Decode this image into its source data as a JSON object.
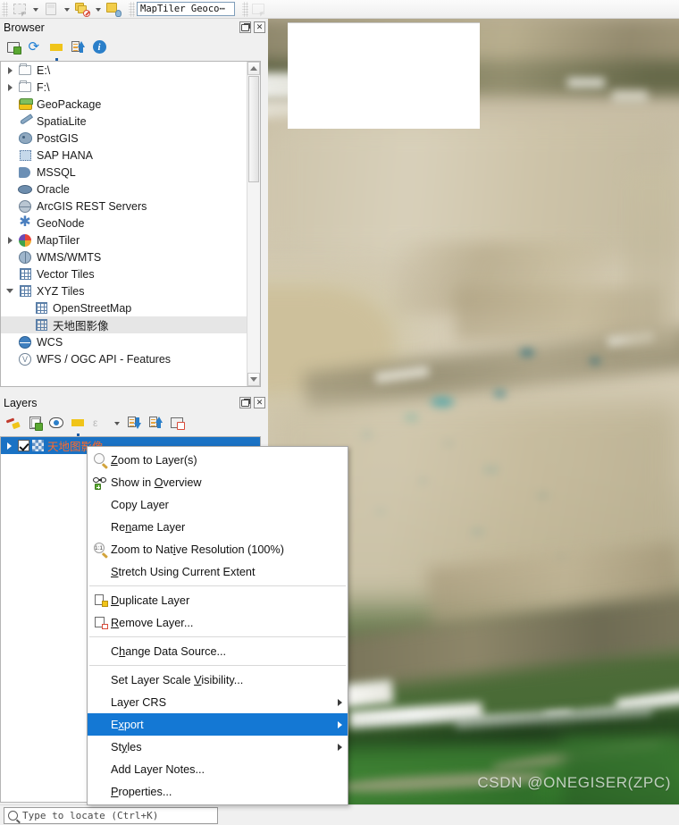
{
  "toolbar": {
    "items": [
      {
        "name": "select-features-tool",
        "icon": "select-icon",
        "disabled": true
      },
      {
        "name": "select-dropdown",
        "icon": "chevron-down-icon"
      },
      {
        "name": "deselect-features-tool",
        "icon": "deselect-icon",
        "disabled": true
      },
      {
        "name": "deselect-dropdown",
        "icon": "chevron-down-icon"
      },
      {
        "name": "open-attribute-table",
        "icon": "layers-remove-icon"
      },
      {
        "name": "attribute-dropdown",
        "icon": "chevron-down-icon"
      },
      {
        "name": "show-map-tips",
        "icon": "layer-tip-icon"
      }
    ],
    "geocoder_value": "MapTiler Geoco⋯",
    "geocoder_placeholder": "MapTiler Geocoder"
  },
  "browser": {
    "title": "Browser",
    "window_buttons": [
      {
        "name": "float-panel-button",
        "glyph": "❐"
      },
      {
        "name": "close-panel-button",
        "glyph": "✕"
      }
    ],
    "toolbar": [
      {
        "name": "add-selected-layers-button",
        "icon": "new-layer-icon"
      },
      {
        "name": "refresh-button",
        "icon": "refresh-icon"
      },
      {
        "name": "filter-browser-button",
        "icon": "filter-icon"
      },
      {
        "name": "collapse-all-button",
        "icon": "collapse-all-icon"
      },
      {
        "name": "enable-properties-widget-button",
        "icon": "info-icon"
      }
    ],
    "tree": [
      {
        "label": "E:\\",
        "icon": "folder-icon",
        "indent": 0,
        "twisty": "closed",
        "selected": false
      },
      {
        "label": "F:\\",
        "icon": "folder-icon",
        "indent": 0,
        "twisty": "closed",
        "selected": false
      },
      {
        "label": "GeoPackage",
        "icon": "geopackage-icon",
        "indent": 0,
        "twisty": "none",
        "selected": false
      },
      {
        "label": "SpatiaLite",
        "icon": "spatialite-icon",
        "indent": 0,
        "twisty": "none",
        "selected": false
      },
      {
        "label": "PostGIS",
        "icon": "postgis-icon",
        "indent": 0,
        "twisty": "none",
        "selected": false
      },
      {
        "label": "SAP HANA",
        "icon": "sap-hana-icon",
        "indent": 0,
        "twisty": "none",
        "selected": false
      },
      {
        "label": "MSSQL",
        "icon": "mssql-icon",
        "indent": 0,
        "twisty": "none",
        "selected": false
      },
      {
        "label": "Oracle",
        "icon": "oracle-icon",
        "indent": 0,
        "twisty": "none",
        "selected": false
      },
      {
        "label": "ArcGIS REST Servers",
        "icon": "arcgis-icon",
        "indent": 0,
        "twisty": "none",
        "selected": false
      },
      {
        "label": "GeoNode",
        "icon": "geonode-icon",
        "indent": 0,
        "twisty": "none",
        "selected": false
      },
      {
        "label": "MapTiler",
        "icon": "maptiler-icon",
        "indent": 0,
        "twisty": "closed",
        "selected": false
      },
      {
        "label": "WMS/WMTS",
        "icon": "wms-icon",
        "indent": 0,
        "twisty": "none",
        "selected": false
      },
      {
        "label": "Vector Tiles",
        "icon": "grid-icon",
        "indent": 0,
        "twisty": "none",
        "selected": false
      },
      {
        "label": "XYZ Tiles",
        "icon": "grid-icon",
        "indent": 0,
        "twisty": "open",
        "selected": false
      },
      {
        "label": "OpenStreetMap",
        "icon": "grid-icon",
        "indent": 1,
        "twisty": "none",
        "selected": false
      },
      {
        "label": "天地图影像",
        "icon": "grid-icon",
        "indent": 1,
        "twisty": "none",
        "selected": true
      },
      {
        "label": "WCS",
        "icon": "wcs-icon",
        "indent": 0,
        "twisty": "none",
        "selected": false
      },
      {
        "label": "WFS / OGC API - Features",
        "icon": "wfs-icon",
        "indent": 0,
        "twisty": "none",
        "selected": false
      }
    ]
  },
  "layers": {
    "title": "Layers",
    "window_buttons": [
      {
        "name": "float-panel-button",
        "glyph": "❐"
      },
      {
        "name": "close-panel-button",
        "glyph": "✕"
      }
    ],
    "toolbar": [
      {
        "name": "open-layer-styling-panel-button",
        "icon": "styling-brush-icon"
      },
      {
        "name": "add-group-button",
        "icon": "add-group-icon"
      },
      {
        "name": "manage-map-themes-button",
        "icon": "eye-icon"
      },
      {
        "name": "filter-legend-button",
        "icon": "filter-icon"
      },
      {
        "name": "filter-legend-expression-button",
        "icon": "expression-icon",
        "disabled": true
      },
      {
        "name": "expression-dropdown",
        "icon": "chevron-down-icon"
      },
      {
        "name": "expand-all-button",
        "icon": "expand-all-icon"
      },
      {
        "name": "collapse-all-button",
        "icon": "collapse-all-icon"
      },
      {
        "name": "remove-layer-button",
        "icon": "remove-layer-icon"
      }
    ],
    "items": [
      {
        "label": "天地图影像",
        "checked": true,
        "selected": true,
        "icon": "raster-checker-icon"
      }
    ]
  },
  "context_menu": {
    "items": [
      {
        "type": "item",
        "name": "zoom-to-layers",
        "label": "Zoom to Layer(s)",
        "mnemonic": "Z",
        "icon": "zoom-layer-icon",
        "submenu": false,
        "highlighted": false
      },
      {
        "type": "item",
        "name": "show-in-overview",
        "label": "Show in Overview",
        "mnemonic": "O",
        "icon": "glasses-icon",
        "submenu": false,
        "highlighted": false
      },
      {
        "type": "item",
        "name": "copy-layer",
        "label": "Copy Layer",
        "mnemonic": "",
        "icon": "",
        "submenu": false,
        "highlighted": false
      },
      {
        "type": "item",
        "name": "rename-layer",
        "label": "Rename Layer",
        "mnemonic": "n",
        "icon": "",
        "submenu": false,
        "highlighted": false
      },
      {
        "type": "item",
        "name": "zoom-to-native-resolution",
        "label": "Zoom to Native Resolution (100%)",
        "mnemonic": "i",
        "icon": "zoom-native-icon",
        "submenu": false,
        "highlighted": false
      },
      {
        "type": "item",
        "name": "stretch-using-current-extent",
        "label": "Stretch Using Current Extent",
        "mnemonic": "S",
        "icon": "",
        "submenu": false,
        "highlighted": false
      },
      {
        "type": "separator"
      },
      {
        "type": "item",
        "name": "duplicate-layer",
        "label": "Duplicate Layer",
        "mnemonic": "D",
        "icon": "duplicate-icon",
        "submenu": false,
        "highlighted": false
      },
      {
        "type": "item",
        "name": "remove-layer",
        "label": "Remove Layer...",
        "mnemonic": "R",
        "icon": "remove-icon",
        "submenu": false,
        "highlighted": false
      },
      {
        "type": "separator"
      },
      {
        "type": "item",
        "name": "change-data-source",
        "label": "Change Data Source...",
        "mnemonic": "h",
        "icon": "",
        "submenu": false,
        "highlighted": false
      },
      {
        "type": "separator"
      },
      {
        "type": "item",
        "name": "set-layer-scale-visibility",
        "label": "Set Layer Scale Visibility...",
        "mnemonic": "V",
        "icon": "",
        "submenu": false,
        "highlighted": false
      },
      {
        "type": "item",
        "name": "layer-crs",
        "label": "Layer CRS",
        "mnemonic": "",
        "icon": "",
        "submenu": true,
        "highlighted": false
      },
      {
        "type": "item",
        "name": "export",
        "label": "Export",
        "mnemonic": "x",
        "icon": "",
        "submenu": true,
        "highlighted": true
      },
      {
        "type": "item",
        "name": "styles",
        "label": "Styles",
        "mnemonic": "y",
        "icon": "",
        "submenu": true,
        "highlighted": false
      },
      {
        "type": "item",
        "name": "add-layer-notes",
        "label": "Add Layer Notes...",
        "mnemonic": "",
        "icon": "",
        "submenu": false,
        "highlighted": false
      },
      {
        "type": "item",
        "name": "properties",
        "label": "Properties...",
        "mnemonic": "P",
        "icon": "",
        "submenu": false,
        "highlighted": false
      }
    ]
  },
  "map": {
    "watermark": "CSDN @ONEGISER(ZPC)",
    "loading_tile_visible": true
  },
  "statusbar": {
    "locator_placeholder": "Type to locate (Ctrl+K)",
    "locator_value": ""
  },
  "colors": {
    "selection_blue": "#1a72c4",
    "menu_highlight": "#1478d4",
    "layer_name_orange": "#ff6a2a",
    "panel_bg": "#f0f0f0"
  }
}
